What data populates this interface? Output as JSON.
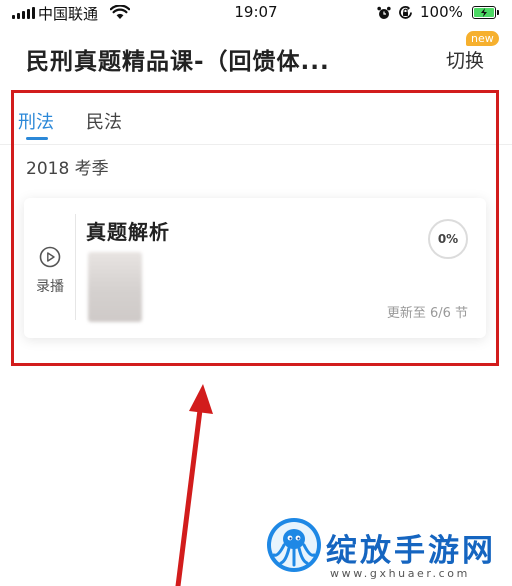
{
  "status_bar": {
    "carrier": "中国联通",
    "time": "19:07",
    "battery_percent": "100%",
    "icons": [
      "signal-icon",
      "wifi-icon",
      "alarm-icon",
      "rotation-lock-icon",
      "battery-charging-icon"
    ]
  },
  "header": {
    "title": "民刑真题精品课-（回馈体...",
    "switch_label": "切换",
    "new_badge": "new"
  },
  "tabs": [
    {
      "label": "刑法",
      "active": true
    },
    {
      "label": "民法",
      "active": false
    }
  ],
  "season_label": "2018 考季",
  "course_card": {
    "type_label": "录播",
    "type_icon": "play-circle-icon",
    "title": "真题解析",
    "progress_text": "0%",
    "progress": 0,
    "update_text": "更新至 6/6 节"
  },
  "watermark": {
    "text": "绽放手游网",
    "url": "www.gxhuaer.com",
    "logo_icon": "octopus-logo-icon"
  },
  "colors": {
    "accent": "#2b88d8",
    "highlight": "#d21c1c",
    "badge": "#f6b02e",
    "battery": "#4cd964",
    "watermark": "#1565c0"
  }
}
